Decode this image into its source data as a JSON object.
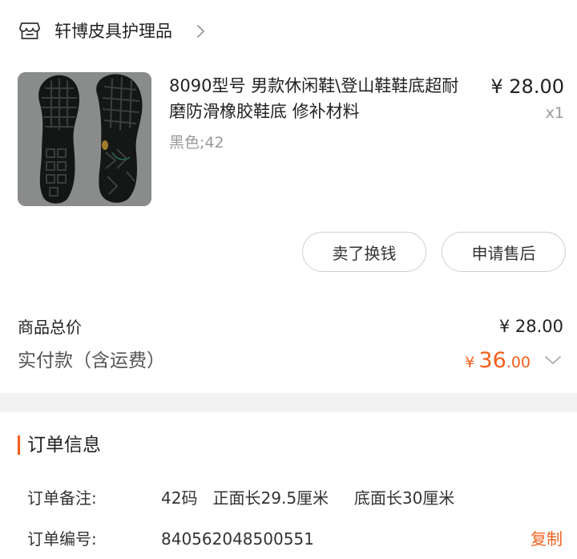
{
  "store": {
    "name": "轩博皮具护理品"
  },
  "product": {
    "title": "8090型号 男款休闲鞋\\登山鞋鞋底超耐磨防滑橡胶鞋底 修补材料",
    "price": "¥ 28.00",
    "quantity": "x1",
    "sku": "黑色;42"
  },
  "actions": {
    "sell_label": "卖了换钱",
    "after_sale_label": "申请售后"
  },
  "totals": {
    "goods_label": "商品总价",
    "goods_value": "¥ 28.00",
    "paid_label": "实付款（含运费）",
    "paid_currency": "¥",
    "paid_integer": "36",
    "paid_decimal": ".00"
  },
  "order_info": {
    "title": "订单信息",
    "remark_label": "订单备注:",
    "remark_value": "42码   正面长29.5厘米     底面长30厘米",
    "number_label": "订单编号:",
    "number_value": "840562048500551",
    "copy_label": "复制"
  },
  "colors": {
    "accent": "#f2601c",
    "muted_text": "#999999",
    "section_gap": "#f2f2f2"
  }
}
